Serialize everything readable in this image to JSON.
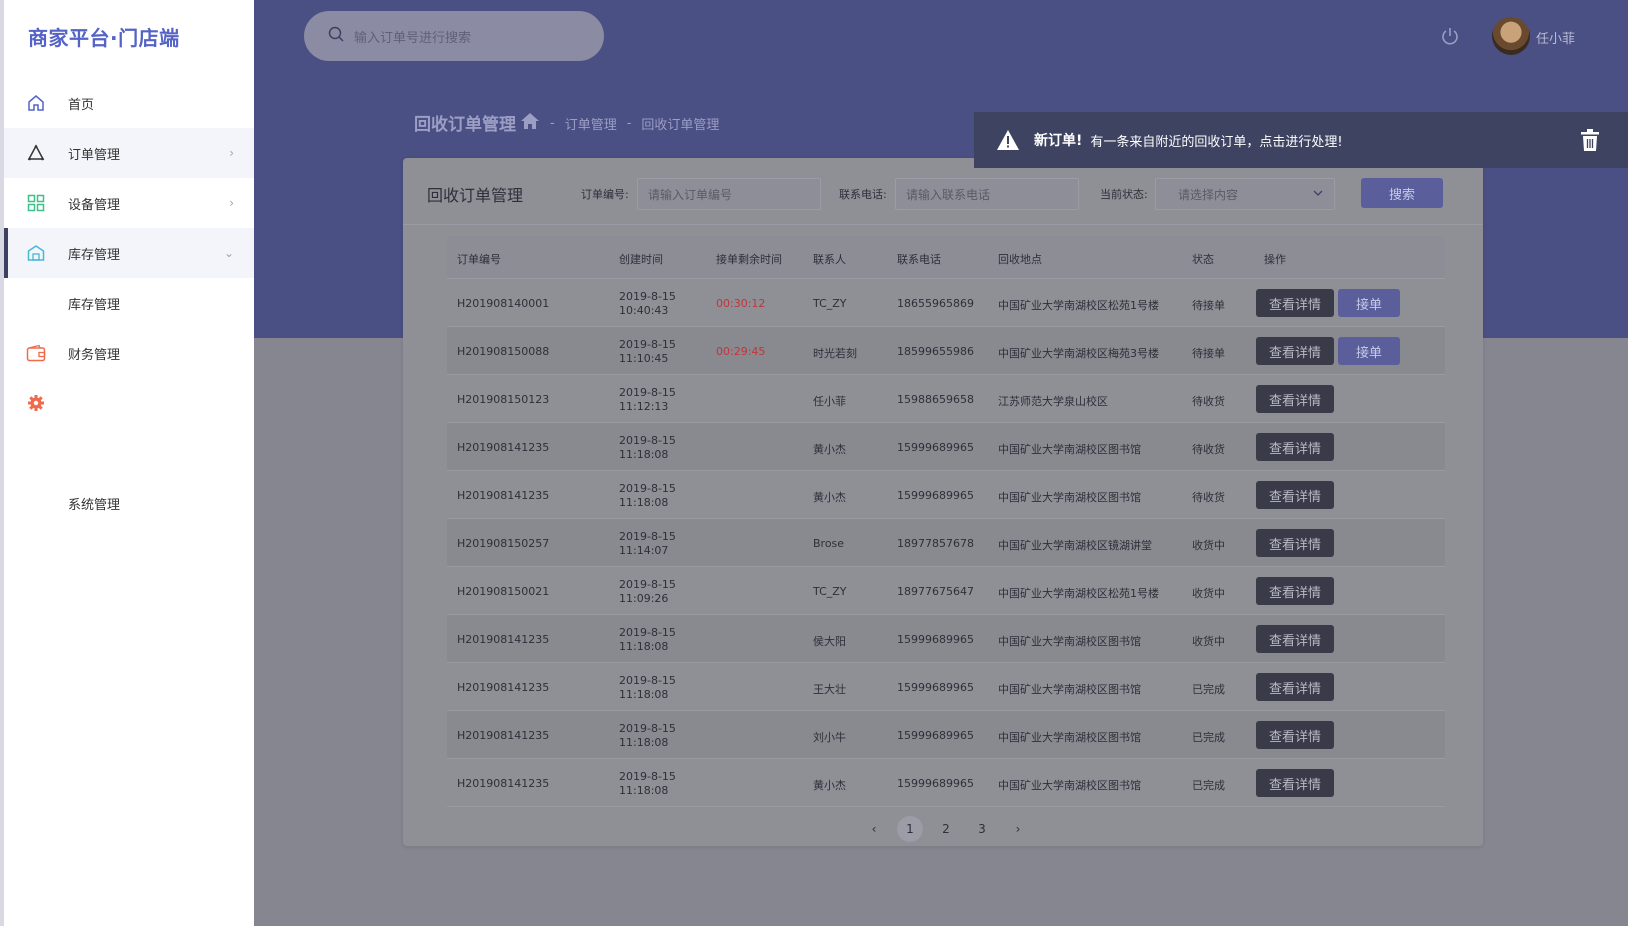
{
  "app": {
    "logo": "商家平台·门店端"
  },
  "sidebar": {
    "items": [
      {
        "label": "首页",
        "icon": "home-icon",
        "color": "#5563c7"
      },
      {
        "label": "订单管理",
        "icon": "triangle-icon",
        "color": "#333333"
      },
      {
        "label": "设备管理",
        "icon": "grid-icon",
        "color": "#3fbf8a"
      },
      {
        "label": "库存管理",
        "icon": "warehouse-icon",
        "color": "#46b7d6"
      },
      {
        "label": "库存管理",
        "icon": "",
        "color": ""
      },
      {
        "label": "财务管理",
        "icon": "wallet-icon",
        "color": "#f06a4b"
      },
      {
        "label": "",
        "icon": "gear-icon",
        "color": "#f06a4b"
      },
      {
        "label": "系统管理",
        "icon": "",
        "color": ""
      }
    ]
  },
  "header": {
    "search_placeholder": "输入订单号进行搜索",
    "username": "任小菲"
  },
  "page": {
    "title": "回收订单管理",
    "breadcrumb": [
      "订单管理",
      "回收订单管理"
    ]
  },
  "card": {
    "title": "回收订单管理",
    "filters": {
      "order_label": "订单编号:",
      "order_placeholder": "请输入订单编号",
      "phone_label": "联系电话:",
      "phone_placeholder": "请输入联系电话",
      "status_label": "当前状态:",
      "status_placeholder": "请选择内容",
      "search_button": "搜索"
    }
  },
  "table": {
    "headers": [
      "订单编号",
      "创建时间",
      "接单剩余时间",
      "联系人",
      "联系电话",
      "回收地点",
      "状态",
      "操作"
    ],
    "detail_label": "查看详情",
    "accept_label": "接单",
    "rows": [
      {
        "id": "H201908140001",
        "date": "2019-8-15",
        "time": "10:40:43",
        "remain": "00:30:12",
        "contact": "TC_ZY",
        "phone": "18655965869",
        "place": "中国矿业大学南湖校区松苑1号楼",
        "status": "待接单",
        "accept": true
      },
      {
        "id": "H201908150088",
        "date": "2019-8-15",
        "time": "11:10:45",
        "remain": "00:29:45",
        "contact": "时光若刻",
        "phone": "18599655986",
        "place": "中国矿业大学南湖校区梅苑3号楼",
        "status": "待接单",
        "accept": true
      },
      {
        "id": "H201908150123",
        "date": "2019-8-15",
        "time": "11:12:13",
        "remain": "",
        "contact": "任小菲",
        "phone": "15988659658",
        "place": "江苏师范大学泉山校区",
        "status": "待收货",
        "accept": false
      },
      {
        "id": "H201908141235",
        "date": "2019-8-15",
        "time": "11:18:08",
        "remain": "",
        "contact": "黄小杰",
        "phone": "15999689965",
        "place": "中国矿业大学南湖校区图书馆",
        "status": "待收货",
        "accept": false
      },
      {
        "id": "H201908141235",
        "date": "2019-8-15",
        "time": "11:18:08",
        "remain": "",
        "contact": "黄小杰",
        "phone": "15999689965",
        "place": "中国矿业大学南湖校区图书馆",
        "status": "待收货",
        "accept": false
      },
      {
        "id": "H201908150257",
        "date": "2019-8-15",
        "time": "11:14:07",
        "remain": "",
        "contact": "Brose",
        "phone": "18977857678",
        "place": "中国矿业大学南湖校区镜湖讲堂",
        "status": "收货中",
        "accept": false
      },
      {
        "id": "H201908150021",
        "date": "2019-8-15",
        "time": "11:09:26",
        "remain": "",
        "contact": "TC_ZY",
        "phone": "18977675647",
        "place": "中国矿业大学南湖校区松苑1号楼",
        "status": "收货中",
        "accept": false
      },
      {
        "id": "H201908141235",
        "date": "2019-8-15",
        "time": "11:18:08",
        "remain": "",
        "contact": "侯大阳",
        "phone": "15999689965",
        "place": "中国矿业大学南湖校区图书馆",
        "status": "收货中",
        "accept": false
      },
      {
        "id": "H201908141235",
        "date": "2019-8-15",
        "time": "11:18:08",
        "remain": "",
        "contact": "王大壮",
        "phone": "15999689965",
        "place": "中国矿业大学南湖校区图书馆",
        "status": "已完成",
        "accept": false
      },
      {
        "id": "H201908141235",
        "date": "2019-8-15",
        "time": "11:18:08",
        "remain": "",
        "contact": "刘小牛",
        "phone": "15999689965",
        "place": "中国矿业大学南湖校区图书馆",
        "status": "已完成",
        "accept": false
      },
      {
        "id": "H201908141235",
        "date": "2019-8-15",
        "time": "11:18:08",
        "remain": "",
        "contact": "黄小杰",
        "phone": "15999689965",
        "place": "中国矿业大学南湖校区图书馆",
        "status": "已完成",
        "accept": false
      }
    ]
  },
  "pagination": {
    "pages": [
      "1",
      "2",
      "3"
    ],
    "current": "1"
  },
  "notification": {
    "title": "新订单!",
    "message": "有一条来自附近的回收订单，点击进行处理!"
  }
}
